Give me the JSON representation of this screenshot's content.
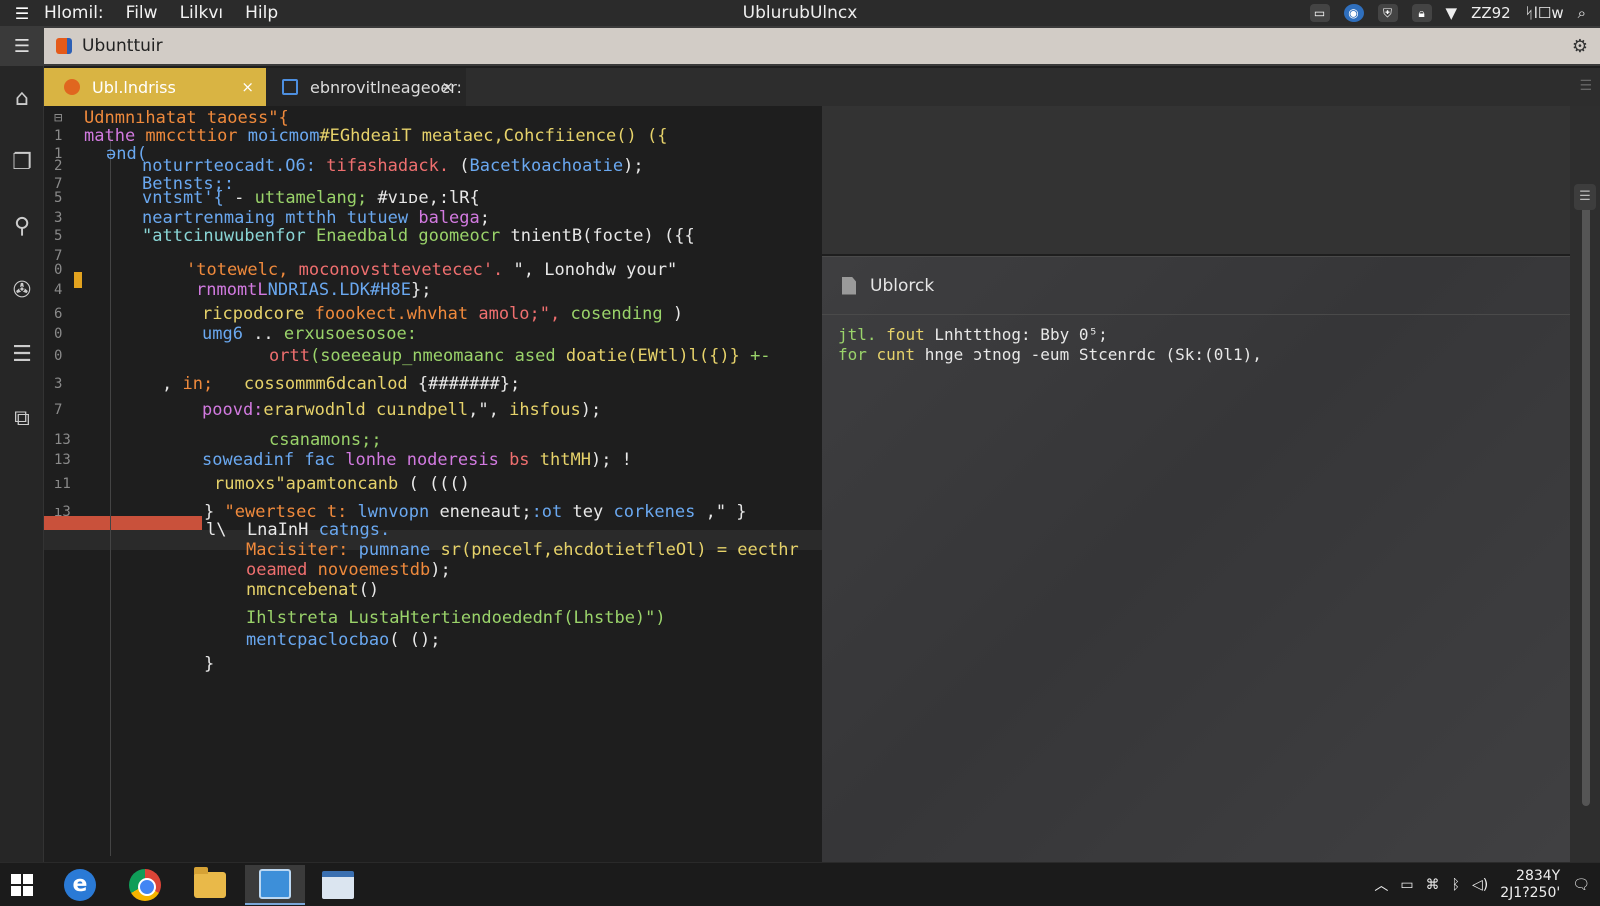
{
  "topbar": {
    "menu": [
      "Hlomil:",
      "Filw",
      "Lilkvı",
      "Hilp"
    ],
    "title": "UblurubUlncx",
    "tray_text": "ZZ92",
    "tray_extra": "ᛋl☐w"
  },
  "appbar": {
    "name": "Ubunttuir"
  },
  "tabs": [
    {
      "label": "Ubl.lndriss",
      "close": "×"
    },
    {
      "label": "ebnrovitlneageoer:",
      "close": "×"
    }
  ],
  "editor": {
    "lines": [
      {
        "ln": "⊟",
        "indent": 40,
        "parts": [
          [
            "c-o",
            "Udnmnıhatat taoess\"{"
          ]
        ]
      },
      {
        "ln": "1",
        "indent": 40,
        "parts": [
          [
            "c-p",
            "mathe "
          ],
          [
            "c-o",
            "mmccttior "
          ],
          [
            "c-b",
            "moicmom"
          ],
          [
            "c-y",
            "#EGhdeaiT "
          ],
          [
            "c-y",
            "meataec,Cohcfiience() ({"
          ]
        ]
      },
      {
        "ln": "1",
        "indent": 62,
        "parts": [
          [
            "c-b",
            "ənd("
          ]
        ]
      },
      {
        "ln": "2",
        "indent": 98,
        "parts": [
          [
            "c-b",
            "noturrteocadt.O6: "
          ],
          [
            "c-r",
            "tifashadack. "
          ],
          [
            "c-w",
            "("
          ],
          [
            "c-b",
            "Bacetkoachoatie"
          ],
          [
            "c-w",
            ");"
          ]
        ]
      },
      {
        "ln": "7",
        "indent": 98,
        "parts": [
          [
            "c-b",
            "Betnsts;:"
          ]
        ]
      },
      {
        "ln": "5",
        "indent": 98,
        "parts": [
          [
            "c-b",
            "vntsmt'{ "
          ],
          [
            "c-w",
            "- "
          ],
          [
            "c-g",
            "uttamelang; "
          ],
          [
            "c-w",
            "#vıᴅe,:lR{"
          ]
        ]
      },
      {
        "ln": "3",
        "indent": 98,
        "parts": [
          [
            "c-b",
            "neartrenmaing mtthh tutuew "
          ],
          [
            "c-p",
            "balega"
          ],
          [
            "c-w",
            ";"
          ]
        ]
      },
      {
        "ln": "5",
        "indent": 98,
        "parts": [
          [
            "c-c",
            "\"attcinuwubenfor "
          ],
          [
            "c-g",
            "Enaedbald goomeocr "
          ],
          [
            "c-w",
            "tnientB(focte) ({{"
          ]
        ]
      },
      {
        "ln": "7",
        "indent": 142,
        "parts": []
      },
      {
        "ln": "0",
        "indent": 142,
        "parts": [
          [
            "c-o",
            "'totewelc, "
          ],
          [
            "c-r",
            "moconovsttevetecec'. "
          ],
          [
            "c-w",
            "\", Lonohdw your\""
          ]
        ]
      },
      {
        "ln": "4",
        "indent": 152,
        "parts": [
          [
            "c-p",
            "rnmomtL"
          ],
          [
            "c-b",
            "NDRIAS.LDK#H8E"
          ],
          [
            "c-w",
            "};"
          ]
        ]
      },
      {
        "ln": "6",
        "indent": 158,
        "parts": [
          [
            "c-y",
            "ricpodcore "
          ],
          [
            "c-o",
            "foookect.whvhat "
          ],
          [
            "c-r",
            "amolo;\", "
          ],
          [
            "c-g",
            "cosending "
          ],
          [
            "c-w",
            ")"
          ]
        ]
      },
      {
        "ln": "0",
        "indent": 158,
        "parts": [
          [
            "c-b",
            "umg6"
          ],
          [
            "c-w",
            " .. "
          ],
          [
            "c-g",
            "erxusoesosoe:"
          ]
        ]
      },
      {
        "ln": "0",
        "indent": 225,
        "parts": [
          [
            "c-r",
            "ortt"
          ],
          [
            "c-g",
            "(soeeeaup_nmeomaanc ased "
          ],
          [
            "c-y",
            "doatie(EWtl)l({)} "
          ],
          [
            "c-g",
            "+-"
          ]
        ]
      },
      {
        "ln": "3",
        "indent": 118,
        "parts": [
          [
            "c-w",
            ", "
          ],
          [
            "c-o",
            "in;   "
          ],
          [
            "c-y",
            "cossommm6dcanlod "
          ],
          [
            "c-w",
            "{#######};"
          ]
        ]
      },
      {
        "ln": "7",
        "indent": 158,
        "parts": [
          [
            "c-p",
            "poovd:"
          ],
          [
            "c-y",
            "erarwodnld cuındpell"
          ],
          [
            "c-w",
            ",\", "
          ],
          [
            "c-y",
            "ihsfous"
          ],
          [
            "c-w",
            ");"
          ]
        ]
      },
      {
        "ln": "13",
        "indent": 225,
        "parts": [
          [
            "c-g",
            "csanamons;;"
          ]
        ]
      },
      {
        "ln": "13",
        "indent": 158,
        "parts": [
          [
            "c-b",
            "soweadinf fac "
          ],
          [
            "c-p",
            "lonhe noderesis "
          ],
          [
            "c-r",
            "bs "
          ],
          [
            "c-y",
            "thtMH"
          ],
          [
            "c-w",
            "); !"
          ]
        ]
      },
      {
        "ln": "ı1",
        "indent": 170,
        "parts": [
          [
            "c-y",
            "rumoxs\"apamtoncanb "
          ],
          [
            "c-w",
            "( ((()"
          ]
        ]
      },
      {
        "ln": "ı3",
        "indent": 160,
        "parts": [
          [
            "c-w",
            "} "
          ],
          [
            "c-o",
            "\"ewertsec t: "
          ],
          [
            "c-b",
            "lwnvopn "
          ],
          [
            "c-w",
            "eneneaut;"
          ],
          [
            "c-b",
            ":ot "
          ],
          [
            "c-w",
            "tey "
          ],
          [
            "c-b",
            "corkenes "
          ],
          [
            "c-w",
            ",\" }"
          ]
        ]
      },
      {
        "ln": "",
        "indent": 162,
        "parts": [
          [
            "c-w",
            "l\\  LnaInH "
          ],
          [
            "c-b",
            "catngs."
          ]
        ]
      },
      {
        "ln": "",
        "indent": 202,
        "parts": [
          [
            "c-o",
            "Macisiter: "
          ],
          [
            "c-b",
            "pumnane "
          ],
          [
            "c-y",
            "sr(pnecelf,ehcdotietfleOl) = eecthr"
          ]
        ]
      },
      {
        "ln": "",
        "indent": 202,
        "parts": [
          [
            "c-r",
            "oeamed "
          ],
          [
            "c-o",
            "novoemestdb"
          ],
          [
            "c-w",
            ");"
          ]
        ]
      },
      {
        "ln": "",
        "indent": 202,
        "parts": [
          [
            "c-y",
            "nmcncebenat"
          ],
          [
            "c-w",
            "()"
          ]
        ]
      },
      {
        "ln": "",
        "indent": 202,
        "parts": [
          [
            "c-g",
            "Ihlstreta LustaHtertiendoedednf(Lhstbe)\")"
          ]
        ]
      },
      {
        "ln": "",
        "indent": 202,
        "parts": [
          [
            "c-b",
            "mentcpaclocbao"
          ],
          [
            "c-w",
            "( ();"
          ]
        ]
      },
      {
        "ln": "",
        "indent": 160,
        "parts": [
          [
            "c-w",
            "}"
          ]
        ]
      }
    ]
  },
  "console": {
    "title": "Ublorck",
    "lines": [
      [
        [
          "c-g",
          "jtl. "
        ],
        [
          "c-y",
          "fout "
        ],
        [
          "c-w",
          "Lnhttthog: Bby 0⁵;"
        ]
      ],
      [
        [
          "c-g",
          "for "
        ],
        [
          "c-y",
          "cunt "
        ],
        [
          "c-w",
          "hnge ɔtnog -eum Stcenrdc (Sk:(0l1),"
        ]
      ]
    ]
  },
  "taskbar": {
    "time": "2834Y",
    "date": "2J1?250'"
  }
}
